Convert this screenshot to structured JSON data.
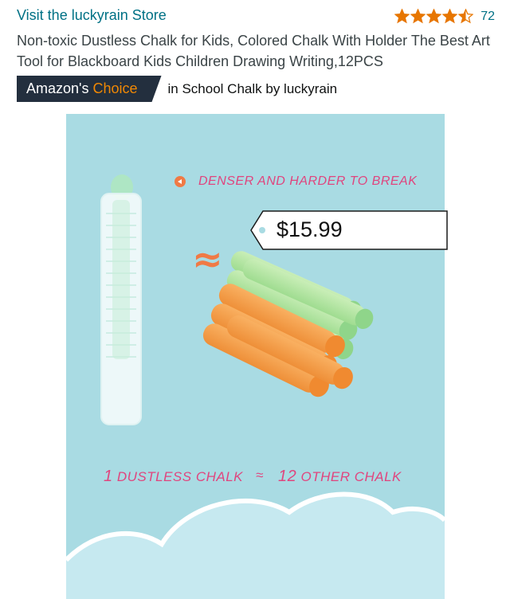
{
  "store": {
    "link_text": "Visit the luckyrain Store"
  },
  "rating": {
    "stars": 4.5,
    "count": "72",
    "star_color": "#e77600"
  },
  "product": {
    "title": "Non-toxic Dustless Chalk for Kids, Colored Chalk With Holder The Best Art Tool for Blackboard Kids Children Drawing Writing,12PCS"
  },
  "badge": {
    "prefix": "Amazon's",
    "accent": "Choice",
    "context": "in School Chalk by luckyrain",
    "accent_color": "#f08804",
    "background": "#232f3e"
  },
  "image": {
    "tagline": "DENSER AND HARDER TO BREAK",
    "approx_symbol": "≈",
    "caption_left_number": "1",
    "caption_left_text": "DUSTLESS CHALK",
    "caption_mid_symbol": "≈",
    "caption_right_number": "12",
    "caption_right_text": "OTHER CHALK",
    "background": "#a9dbe3",
    "text_color": "#e0457e"
  },
  "price_tag": {
    "price": "$15.99"
  }
}
